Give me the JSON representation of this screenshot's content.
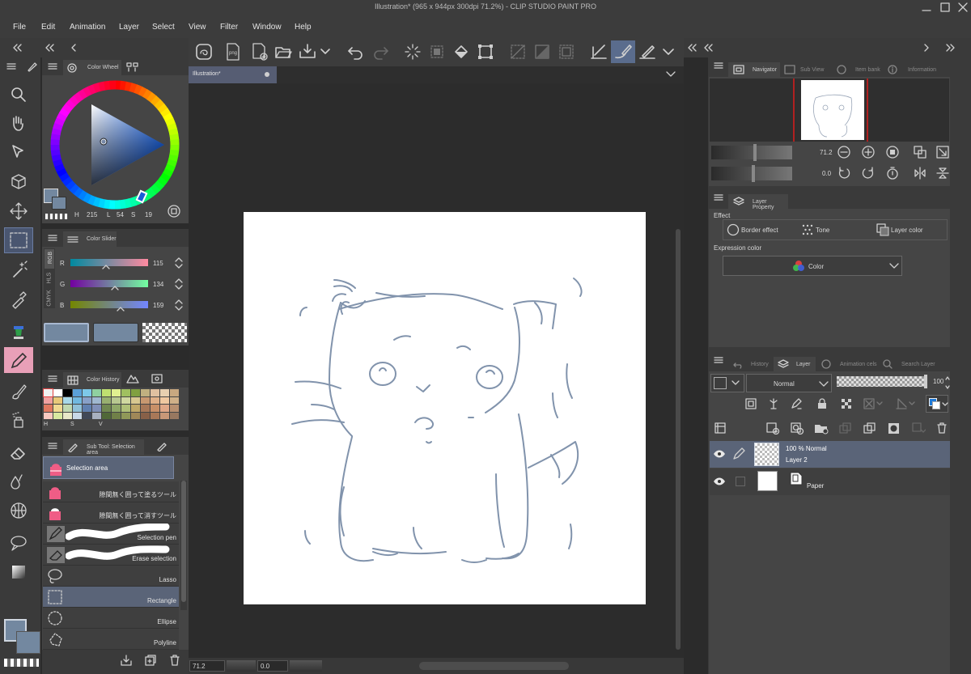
{
  "app": {
    "title": "Illustration* (965 x 944px 300dpi 71.2%)  - CLIP STUDIO PAINT PRO"
  },
  "menu": [
    "File",
    "Edit",
    "Animation",
    "Layer",
    "Select",
    "View",
    "Filter",
    "Window",
    "Help"
  ],
  "document_tab": {
    "label": "Illustration*"
  },
  "color_panel": {
    "tabs": {
      "wheel": "Color Wheel"
    },
    "hls": {
      "h_label": "H",
      "h": "215",
      "l_label": "L",
      "l": "54",
      "s_label": "S",
      "s": "19"
    },
    "main_color": "#7388a0"
  },
  "color_slider": {
    "tab": "Color Slider",
    "modes": [
      "RGB",
      "HLS",
      "CMYK"
    ],
    "channels": [
      {
        "label": "R",
        "value": "115"
      },
      {
        "label": "G",
        "value": "134"
      },
      {
        "label": "B",
        "value": "159"
      }
    ]
  },
  "color_history": {
    "tab": "Color History",
    "labels": [
      "H",
      "S",
      "V"
    ],
    "colors": [
      "#f0f0f0",
      "#ffffff",
      "#000000",
      "#5aa0d8",
      "#7dc8e8",
      "#8fd0a0",
      "#c0e070",
      "#e0f090",
      "#a0c060",
      "#80a040",
      "#c0b080",
      "#e0c0a0",
      "#e8d0b0",
      "#c8a880",
      "#f0a0a0",
      "#e8c878",
      "#a8d8e8",
      "#70b8e0",
      "#88a0c8",
      "#a0b8d0",
      "#98b070",
      "#b8c890",
      "#d0d8a0",
      "#d8c890",
      "#c89870",
      "#e0b088",
      "#f0c8a0",
      "#d0b088",
      "#e07860",
      "#f0d890",
      "#c0d8b0",
      "#90c0d8",
      "#6080b0",
      "#8090b8",
      "#708850",
      "#90a868",
      "#b0c078",
      "#c0a868",
      "#a87858",
      "#c89068",
      "#e0a888",
      "#b89070",
      "#f8c8c0",
      "#d8e8a0",
      "#e8e8c8",
      "#c8d8e8",
      "#404858",
      "#a8b0c0",
      "#506838",
      "#708048",
      "#909858",
      "#a08858",
      "#886048",
      "#a87858",
      "#c89878",
      "#987860"
    ]
  },
  "sub_tool": {
    "tab": "Sub Tool: Selection area",
    "group_label": "Selection area",
    "items": [
      {
        "label": "隙間無く囲って塗るツール"
      },
      {
        "label": "隙間無く囲って消すツール"
      },
      {
        "label": "Selection pen"
      },
      {
        "label": "Erase selection"
      },
      {
        "label": "Lasso"
      },
      {
        "label": "Rectangle"
      },
      {
        "label": "Ellipse"
      },
      {
        "label": "Polyline"
      }
    ]
  },
  "status": {
    "zoom": "71.2",
    "angle": "0.0"
  },
  "navigator": {
    "tabs": [
      "Navigator",
      "Sub View",
      "Item bank",
      "Information"
    ],
    "zoom": "71.2",
    "rotation": "0.0"
  },
  "layer_property": {
    "tab": "Layer Property",
    "effect_label": "Effect",
    "effects": [
      "Border effect",
      "Tone",
      "Layer color"
    ],
    "expression_label": "Expression color",
    "expression_value": "Color"
  },
  "layer_panel": {
    "tabs": [
      "History",
      "Layer",
      "Animation cels",
      "Search Layer"
    ],
    "blend_mode": "Normal",
    "opacity": "100",
    "layers": [
      {
        "mode": "100 % Normal",
        "name": "Layer 2"
      },
      {
        "name": "Paper"
      }
    ]
  }
}
